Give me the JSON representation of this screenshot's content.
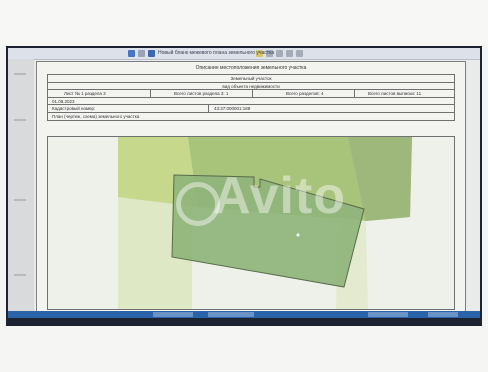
{
  "window": {
    "title": "Новый бланк межевого плана земельного участка"
  },
  "document": {
    "title": "Описание местоположения земельного участка",
    "header": {
      "row1": "Земельный участок",
      "row2": "вид объекта недвижимости",
      "sheet": "Лист № 1 раздела 3",
      "sections_total": "Всего листов раздела 3: 1",
      "sections_count": "Всего разделов: 4",
      "sheets_total": "Всего листов выписки: 11",
      "date": "01.08.2023",
      "cadastral_label": "Кадастровый номер:",
      "cadastral_value": "43:37:000001:189",
      "plan_label": "План (чертеж, схема) земельного участка"
    }
  },
  "watermark": {
    "text": "Avito"
  },
  "colors": {
    "light_green": "#c5d88c",
    "mid_green": "#a8c37a",
    "parcel_green": "#8fb47a",
    "parcel_border": "#596b4a",
    "taskbar": "#2a63a8"
  }
}
